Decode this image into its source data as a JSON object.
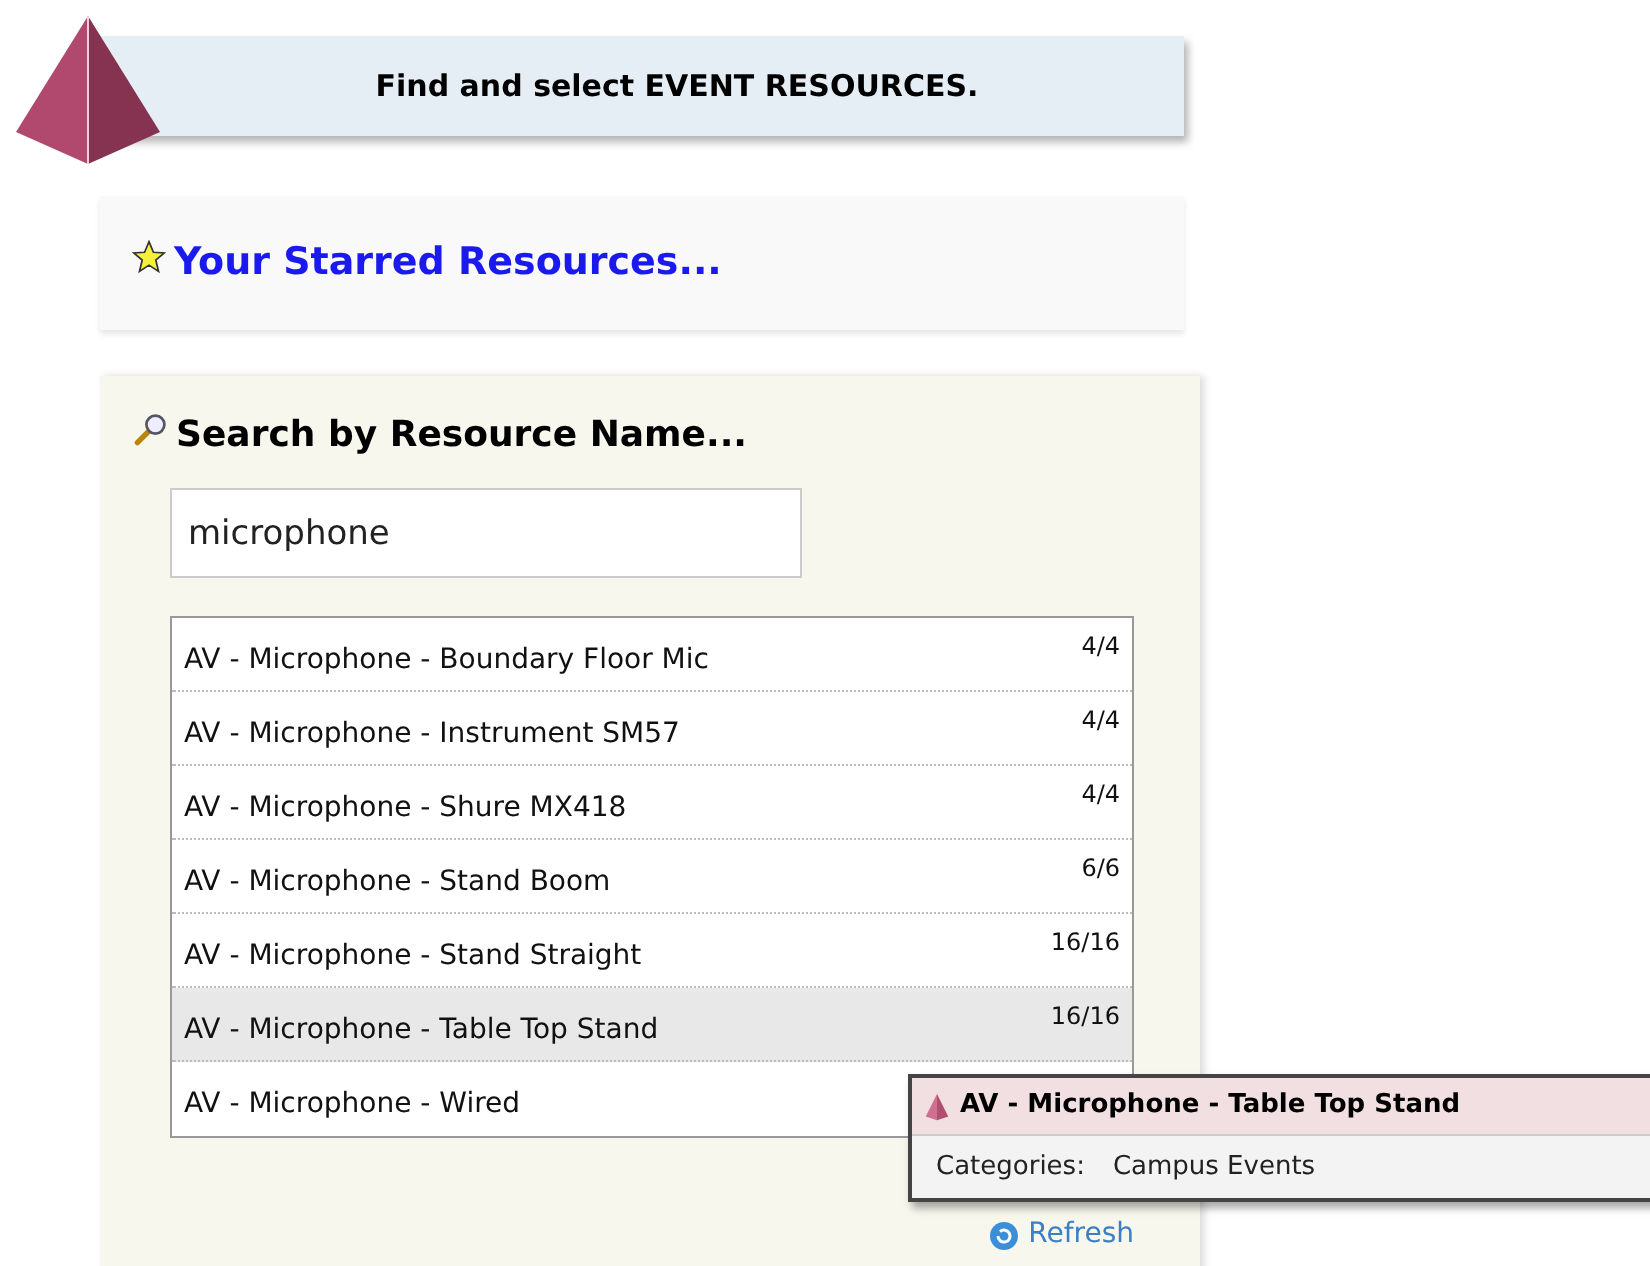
{
  "banner": {
    "title": "Find and select EVENT RESOURCES."
  },
  "starred": {
    "link": "Your Starred Resources..."
  },
  "search": {
    "heading": "Search by Resource Name...",
    "value": "microphone",
    "results": [
      {
        "name": "AV - Microphone - Boundary Floor Mic",
        "count": "4/4",
        "selected": false
      },
      {
        "name": "AV - Microphone - Instrument SM57",
        "count": "4/4",
        "selected": false
      },
      {
        "name": "AV - Microphone - Shure MX418",
        "count": "4/4",
        "selected": false
      },
      {
        "name": "AV - Microphone - Stand Boom",
        "count": "6/6",
        "selected": false
      },
      {
        "name": "AV - Microphone - Stand Straight",
        "count": "16/16",
        "selected": false
      },
      {
        "name": "AV - Microphone - Table Top Stand",
        "count": "16/16",
        "selected": true
      },
      {
        "name": "AV - Microphone - Wired",
        "selected": false
      }
    ],
    "refresh": "Refresh"
  },
  "tooltip": {
    "title": "AV - Microphone - Table Top Stand",
    "label": "Categories:",
    "value": "Campus Events"
  }
}
